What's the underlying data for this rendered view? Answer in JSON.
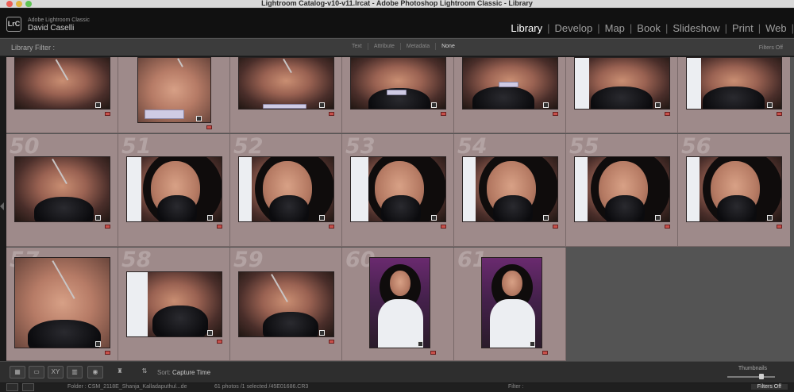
{
  "window": {
    "title": "Lightroom Catalog-v10-v11.lrcat - Adobe Photoshop Lightroom Classic - Library"
  },
  "identity": {
    "logo": "LrC",
    "app": "Adobe Lightroom Classic",
    "user": "David Caselli"
  },
  "modules": [
    "Library",
    "Develop",
    "Map",
    "Book",
    "Slideshow",
    "Print",
    "Web"
  ],
  "active_module": "Library",
  "filter_bar": {
    "label": "Library Filter :",
    "tabs": [
      "Text",
      "Attribute",
      "Metadata",
      "None"
    ],
    "active": "None",
    "right": "Filters Off"
  },
  "grid": {
    "row1": [
      {
        "num": ""
      },
      {
        "num": ""
      },
      {
        "num": ""
      },
      {
        "num": ""
      },
      {
        "num": ""
      },
      {
        "num": ""
      },
      {
        "num": ""
      }
    ],
    "row2": [
      {
        "num": "50"
      },
      {
        "num": "51"
      },
      {
        "num": "52"
      },
      {
        "num": "53"
      },
      {
        "num": "54"
      },
      {
        "num": "55"
      },
      {
        "num": "56"
      }
    ],
    "row3": [
      {
        "num": "57"
      },
      {
        "num": "58"
      },
      {
        "num": "59"
      },
      {
        "num": "60"
      },
      {
        "num": "61"
      }
    ]
  },
  "toolbar": {
    "sort_label": "Sort:",
    "sort_value": "Capture Time",
    "thumbnails_label": "Thumbnails"
  },
  "filmstrip": {
    "folder": "Folder : CSM_2118E_Shanja_Kalladaputhul...de",
    "count": "61 photos /1 selected /45E01686.CR3",
    "filter_label": "Filter :",
    "filters_off": "Filters Off"
  }
}
